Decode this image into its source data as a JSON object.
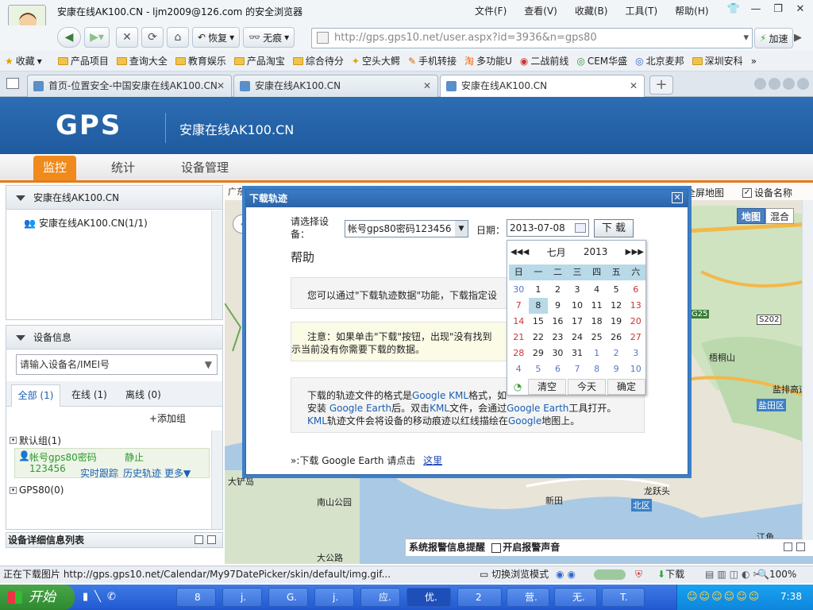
{
  "browser": {
    "title": "安康在线AK100.CN - ljm2009@126.com 的安全浏览器",
    "menu": [
      "文件(F)",
      "查看(V)",
      "收藏(B)",
      "工具(T)",
      "帮助(H)"
    ],
    "nav_buttons": {
      "restore": "恢复",
      "no_trace": "无痕"
    },
    "address": "http://gps.gps10.net/user.aspx?id=3936&n=gps80",
    "speedup": "加速",
    "favorites_label": "收藏",
    "favorites": [
      "产品项目",
      "查询大全",
      "教育娱乐",
      "产品淘宝",
      "综合待分",
      "空头大鳄",
      "手机转接",
      "多功能U",
      "二战前线",
      "CEM华盛",
      "北京麦邦",
      "深圳安科"
    ],
    "tabs": [
      "首页-位置安全-中国安康在线AK100.CN",
      "安康在线AK100.CN",
      "安康在线AK100.CN"
    ]
  },
  "site": {
    "logo": "GPS",
    "name": "安康在线AK100.CN",
    "nav": [
      "监控",
      "统计",
      "设备管理"
    ]
  },
  "left": {
    "tree_header": "安康在线AK100.CN",
    "tree_item": "安康在线AK100.CN(1/1)",
    "device_header": "设备信息",
    "search_placeholder": "请输入设备名/IMEI号",
    "filter_tabs": [
      "全部 (1)",
      "在线 (1)",
      "离线 (0)"
    ],
    "add_group": "+添加组",
    "group_default": "默认组(1)",
    "device_name": "帐号gps80密码",
    "device_pwd": "123456",
    "device_status": "静止",
    "device_actions": [
      "实时跟踪",
      "历史轨迹",
      "更多▼"
    ],
    "group_gps80": "GPS80(0)",
    "detail_list": "设备详细信息列表"
  },
  "map": {
    "top_text": "广东省深圳市福田区...",
    "fullscreen": "全屏地图",
    "device_name_toggle": "设备名称",
    "map_btn": "地图",
    "mix_btn": "混合",
    "labels": [
      "G25",
      "S202",
      "梧桐山",
      "盐田区",
      "盐排高速",
      "南山公园",
      "新田",
      "龙跃头",
      "北区",
      "大铲岛",
      "大公路",
      "江角"
    ],
    "alarm_bar": "系统报警信息提醒",
    "alarm_sound": "开启报警声音"
  },
  "dialog": {
    "title": "下载轨迹",
    "select_label": "请选择设备：",
    "device_option": "帐号gps80密码123456",
    "date_label": "日期：",
    "date_value": "2013-07-08",
    "download_btn": "下 载",
    "help_title": "帮助",
    "info1": "您可以通过\"下载轨迹数据\"功能，下载指定设",
    "info2_line1": "注意：如果单击\"下载\"按钮，出现\"没有找到",
    "info2_line2": "示当前没有你需要下载的数据。",
    "info3_line1a": "下载的轨迹文件的格式是",
    "info3_link1": "Google KML",
    "info3_line1b": "格式，如",
    "info3_line2a": "安装 ",
    "info3_link2": "Google Earth",
    "info3_line2b": "后。双击",
    "info3_link3": "KML",
    "info3_line2c": "文件，会通过",
    "info3_link4": "Google Earth",
    "info3_line2d": "工具打开。",
    "info3_line3a": "KML",
    "info3_line3b": "轨迹文件会将设备的移动痕迹以红线描绘在",
    "info3_line3c": "Google",
    "info3_line3d": "地图上。",
    "earth_text": "»:下载 Google Earth 请点击",
    "earth_link": "这里"
  },
  "calendar": {
    "month": "七月",
    "year": "2013",
    "weekdays": [
      "日",
      "一",
      "二",
      "三",
      "四",
      "五",
      "六"
    ],
    "weeks": [
      [
        "30",
        "1",
        "2",
        "3",
        "4",
        "5",
        "6"
      ],
      [
        "7",
        "8",
        "9",
        "10",
        "11",
        "12",
        "13"
      ],
      [
        "14",
        "15",
        "16",
        "17",
        "18",
        "19",
        "20"
      ],
      [
        "21",
        "22",
        "23",
        "24",
        "25",
        "26",
        "27"
      ],
      [
        "28",
        "29",
        "30",
        "31",
        "1",
        "2",
        "3"
      ],
      [
        "4",
        "5",
        "6",
        "7",
        "8",
        "9",
        "10"
      ]
    ],
    "btn_clear": "清空",
    "btn_today": "今天",
    "btn_ok": "确定"
  },
  "status": {
    "text": "正在下载图片 http://gps.gps10.net/Calendar/My97DatePicker/skin/default/img.gif...",
    "switch_mode": "切换浏览模式",
    "download": "下载",
    "zoom": "100%"
  },
  "taskbar": {
    "start": "开始",
    "tasks": [
      "8",
      "j.",
      "G.",
      "j.",
      "应.",
      "优.",
      "2",
      "营.",
      "无.",
      "T."
    ],
    "time": "7:38"
  }
}
